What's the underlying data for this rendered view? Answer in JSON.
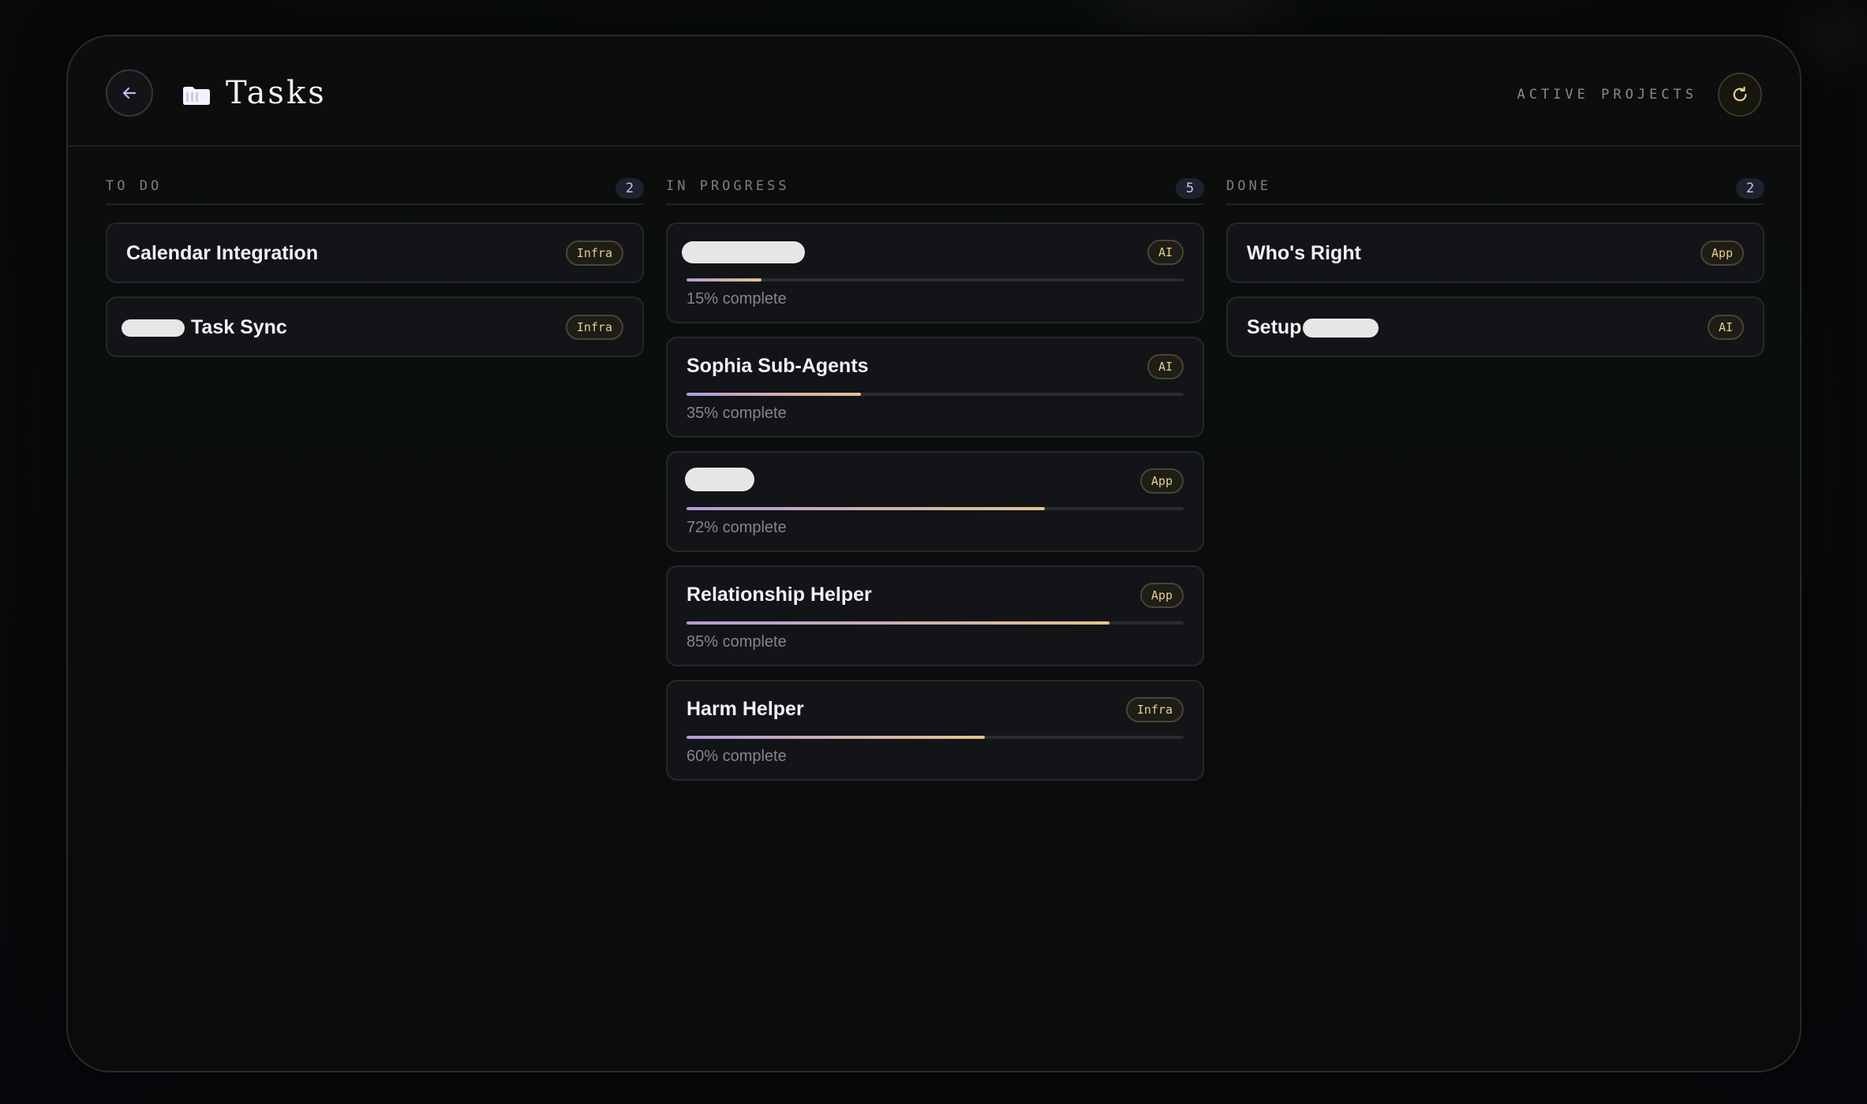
{
  "header": {
    "title": "Tasks",
    "right_label": "ACTIVE PROJECTS",
    "icons": {
      "back": "arrow-left-icon",
      "folder": "folder-icon",
      "refresh": "refresh-icon"
    }
  },
  "colors": {
    "accent_gold": "#e2c58b",
    "accent_lavender": "#b59ad9",
    "card_bg": "#121417",
    "panel_bg": "#0a0d0b"
  },
  "columns": [
    {
      "title": "TO DO",
      "count": "2",
      "cards": [
        {
          "title": "Calendar Integration",
          "tag": "Infra"
        },
        {
          "title": "Task Sync",
          "tag": "Infra",
          "redacted_prefix": true
        }
      ]
    },
    {
      "title": "IN PROGRESS",
      "count": "5",
      "cards": [
        {
          "title": "",
          "tag": "AI",
          "progress": 0.15,
          "progress_label": "15% complete",
          "redacted_title": true
        },
        {
          "title": "Sophia Sub-Agents",
          "tag": "AI",
          "progress": 0.35,
          "progress_label": "35% complete"
        },
        {
          "title": "",
          "tag": "App",
          "progress": 0.72,
          "progress_label": "72% complete",
          "redacted_title": true
        },
        {
          "title": "Relationship Helper",
          "tag": "App",
          "progress": 0.85,
          "progress_label": "85% complete"
        },
        {
          "title": "Harm Helper",
          "tag": "Infra",
          "progress": 0.6,
          "progress_label": "60% complete"
        }
      ]
    },
    {
      "title": "DONE",
      "count": "2",
      "cards": [
        {
          "title": "Who's Right",
          "tag": "App"
        },
        {
          "title": "Setup",
          "tag": "AI",
          "redacted_suffix": true
        }
      ]
    }
  ]
}
